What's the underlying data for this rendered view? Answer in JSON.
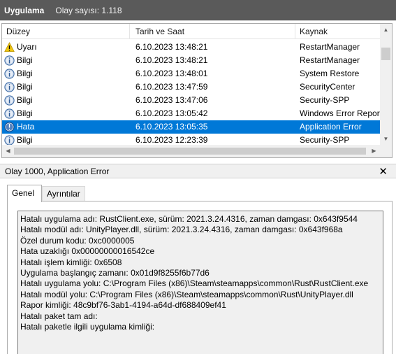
{
  "header": {
    "app_name": "Uygulama",
    "event_count": "Olay sayısı: 1.118"
  },
  "columns": [
    "Düzey",
    "Tarih ve Saat",
    "Kaynak"
  ],
  "events": [
    {
      "level": "Uyarı",
      "icon": "warning-icon",
      "datetime": "6.10.2023 13:48:21",
      "source": "RestartManager",
      "selected": false
    },
    {
      "level": "Bilgi",
      "icon": "info-icon",
      "datetime": "6.10.2023 13:48:21",
      "source": "RestartManager",
      "selected": false
    },
    {
      "level": "Bilgi",
      "icon": "info-icon",
      "datetime": "6.10.2023 13:48:01",
      "source": "System Restore",
      "selected": false
    },
    {
      "level": "Bilgi",
      "icon": "info-icon",
      "datetime": "6.10.2023 13:47:59",
      "source": "SecurityCenter",
      "selected": false
    },
    {
      "level": "Bilgi",
      "icon": "info-icon",
      "datetime": "6.10.2023 13:47:06",
      "source": "Security-SPP",
      "selected": false
    },
    {
      "level": "Bilgi",
      "icon": "info-icon",
      "datetime": "6.10.2023 13:05:42",
      "source": "Windows Error Report",
      "selected": false
    },
    {
      "level": "Hata",
      "icon": "error-icon",
      "datetime": "6.10.2023 13:05:35",
      "source": "Application Error",
      "selected": true
    },
    {
      "level": "Bilgi",
      "icon": "info-icon",
      "datetime": "6.10.2023 12:23:39",
      "source": "Security-SPP",
      "selected": false
    }
  ],
  "detail": {
    "title": "Olay 1000, Application Error",
    "close_glyph": "✕",
    "tabs": [
      "Genel",
      "Ayrıntılar"
    ],
    "lines": [
      "Hatalı uygulama adı: RustClient.exe, sürüm: 2021.3.24.4316, zaman damgası: 0x643f9544",
      "Hatalı modül adı: UnityPlayer.dll, sürüm: 2021.3.24.4316, zaman damgası: 0x643f968a",
      "Özel durum kodu: 0xc0000005",
      "Hata uzaklığı 0x00000000016542ce",
      "Hatalı işlem kimliği: 0x6508",
      "Uygulama başlangıç zamanı: 0x01d9f8255f6b77d6",
      "Hatalı uygulama yolu: C:\\Program Files (x86)\\Steam\\steamapps\\common\\Rust\\RustClient.exe",
      "Hatalı modül yolu: C:\\Program Files (x86)\\Steam\\steamapps\\common\\Rust\\UnityPlayer.dll",
      "Rapor kimliği: 48c9bf76-3ab1-4194-a64d-df688409ef41",
      "Hatalı paket tam adı:",
      "Hatalı paketle ilgili uygulama kimliği:"
    ]
  },
  "colors": {
    "titlebar": "#5a5a5a",
    "selection": "#0078d7",
    "panel_bg": "#f0f0f0",
    "warning": "#f2c811",
    "info": "#4e7fbe"
  },
  "scrollbars": {
    "up": "▲",
    "down": "▼",
    "left": "◀",
    "right": "▶"
  }
}
